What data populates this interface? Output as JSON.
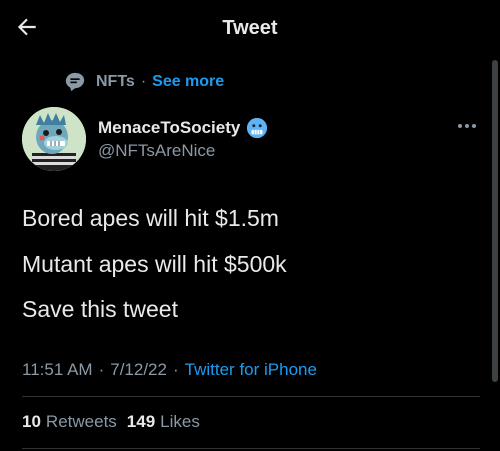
{
  "header": {
    "title": "Tweet"
  },
  "topic": {
    "name": "NFTs",
    "separator": "·",
    "see_more": "See more"
  },
  "author": {
    "display_name": "MenaceToSociety",
    "handle": "@NFTsAreNice",
    "emoji": "cold-face-emoji"
  },
  "tweet": {
    "lines": [
      "Bored apes will hit $1.5m",
      "Mutant apes will hit $500k",
      "Save this tweet"
    ]
  },
  "meta": {
    "time": "11:51 AM",
    "separator": "·",
    "date": "7/12/22",
    "source": "Twitter for iPhone"
  },
  "stats": {
    "retweets_count": "10",
    "retweets_label": "Retweets",
    "likes_count": "149",
    "likes_label": "Likes"
  },
  "colors": {
    "background": "#000000",
    "accent": "#1d9bf0",
    "secondary_text": "#8b98a5",
    "primary_text": "#e7e9ea"
  }
}
